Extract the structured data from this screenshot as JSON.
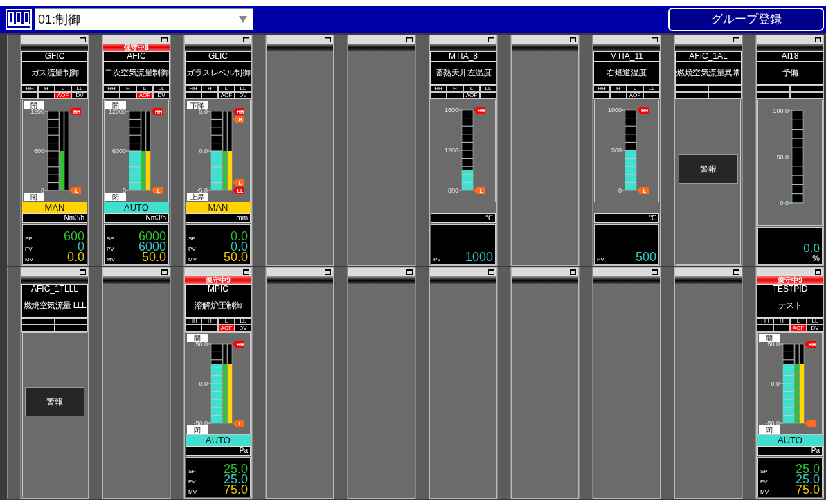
{
  "header": {
    "group_select": {
      "value": "01:制御"
    },
    "register_button": "グループ登録"
  },
  "faceplate_rows": [
    {
      "faceplates": [
        {
          "kind": "controller",
          "tag": "GFIC",
          "description": "ガス流量制御",
          "alarms": [
            {
              "label": "HH"
            },
            {
              "label": "H"
            },
            {
              "label": "L"
            },
            {
              "label": "LL"
            }
          ],
          "flags": [
            {
              "active": false
            },
            {
              "active": false
            },
            {
              "label": "AOF",
              "active": true
            },
            {
              "label": "DV",
              "active": false
            }
          ],
          "top_label": "開",
          "bottom_label": "閉",
          "scale": [
            "1200",
            "600",
            "0"
          ],
          "bars": [
            {
              "kind": "pv",
              "level": 0
            },
            {
              "kind": "sp",
              "level": 0.5
            },
            {
              "kind": "mv",
              "level": 0
            }
          ],
          "markers": [
            {
              "label": "HH",
              "level": 1,
              "color": "#ff0000"
            },
            {
              "label": "L",
              "level": 0,
              "color": "#ff6a1a"
            }
          ],
          "mode": {
            "label": "MAN",
            "kind": "manual"
          },
          "unit": "Nm3/h",
          "values": [
            {
              "label": "SP",
              "value": "600",
              "kind": "sp"
            },
            {
              "label": "PV",
              "value": "0",
              "kind": "pv"
            },
            {
              "label": "MV",
              "value": "0.0",
              "kind": "mv"
            }
          ]
        },
        {
          "kind": "controller",
          "maintenance": "保守中8",
          "tag": "AFIC",
          "description": "二次空気流量制御",
          "alarms": [
            {
              "label": "HH"
            },
            {
              "label": "H"
            },
            {
              "label": "L"
            },
            {
              "label": "LL"
            }
          ],
          "flags": [
            {
              "active": false
            },
            {
              "active": false
            },
            {
              "label": "AOF",
              "active": true
            },
            {
              "label": "DV",
              "active": false
            }
          ],
          "top_label": "開",
          "bottom_label": "閉",
          "scale": [
            "12000",
            "6000",
            "0"
          ],
          "bars": [
            {
              "kind": "pv",
              "level": 0.5
            },
            {
              "kind": "sp",
              "level": 0.5
            },
            {
              "kind": "mv",
              "level": 0.5
            }
          ],
          "markers": [
            {
              "label": "HH",
              "level": 1,
              "color": "#ff0000"
            },
            {
              "label": "L",
              "level": 0,
              "color": "#ff6a1a"
            }
          ],
          "mode": {
            "label": "AUTO",
            "kind": "auto"
          },
          "unit": "Nm3/h",
          "values": [
            {
              "label": "SP",
              "value": "6000",
              "kind": "sp"
            },
            {
              "label": "PV",
              "value": "6000",
              "kind": "pv"
            },
            {
              "label": "MV",
              "value": "50.0",
              "kind": "mv"
            }
          ]
        },
        {
          "kind": "controller",
          "tag": "GLIC",
          "description": "ガラスレベル制御",
          "alarms": [
            {
              "label": "HH"
            },
            {
              "label": "H"
            },
            {
              "label": "L"
            },
            {
              "label": "LL"
            }
          ],
          "flags": [
            {
              "active": false
            },
            {
              "active": false
            },
            {
              "label": "AOF",
              "active": false
            },
            {
              "label": "DV",
              "active": false
            }
          ],
          "top_label": "下降",
          "bottom_label": "上昇",
          "scale": [
            "5.0",
            "0.0",
            "-5.0"
          ],
          "bars": [
            {
              "kind": "pv",
              "level": 0.5
            },
            {
              "kind": "sp",
              "level": 0.5
            },
            {
              "kind": "mv",
              "level": 0.5
            }
          ],
          "markers": [
            {
              "label": "HH",
              "level": 1,
              "color": "#ff0000"
            },
            {
              "label": "H",
              "level": 0.9,
              "color": "#ff6a1a"
            },
            {
              "label": "L",
              "level": 0.1,
              "color": "#ff6a1a"
            },
            {
              "label": "LL",
              "level": 0,
              "color": "#ff0000"
            }
          ],
          "mode": {
            "label": "MAN",
            "kind": "manual"
          },
          "unit": "mm",
          "values": [
            {
              "label": "SP",
              "value": "0.0",
              "kind": "sp"
            },
            {
              "label": "PV",
              "value": "0.0",
              "kind": "pv"
            },
            {
              "label": "MV",
              "value": "50.0",
              "kind": "mv"
            }
          ]
        },
        {
          "kind": "empty"
        },
        {
          "kind": "empty"
        },
        {
          "kind": "indicator",
          "tag": "MTIA_8",
          "description": "蓄熱天井左温度",
          "alarms": [
            {
              "label": "HH"
            },
            {
              "label": "H"
            },
            {
              "label": "L"
            },
            {
              "label": "LL"
            }
          ],
          "flags": [
            {
              "active": false
            },
            {
              "active": false
            },
            {
              "label": "AOF",
              "active": false
            },
            {
              "active": false
            }
          ],
          "scale": [
            "1600",
            "1200",
            "800"
          ],
          "bars": [
            {
              "kind": "pv",
              "level": 0.25
            }
          ],
          "markers": [
            {
              "label": "HH",
              "level": 1,
              "color": "#ff0000"
            },
            {
              "label": "L",
              "level": 0,
              "color": "#ff6a1a"
            }
          ],
          "unit": "℃",
          "values": [
            {
              "label": "PV",
              "value": "1000",
              "kind": "pv"
            }
          ]
        },
        {
          "kind": "empty"
        },
        {
          "kind": "indicator",
          "tag": "MTIA_11",
          "description": "右煙道温度",
          "alarms": [
            {
              "label": "HH"
            },
            {
              "label": "H"
            },
            {
              "label": "L"
            },
            {
              "label": "LL"
            }
          ],
          "flags": [
            {
              "active": false
            },
            {
              "active": false
            },
            {
              "label": "AOF",
              "active": false
            },
            {
              "active": false
            }
          ],
          "scale": [
            "1000",
            "500",
            "0"
          ],
          "bars": [
            {
              "kind": "pv",
              "level": 0.5
            }
          ],
          "markers": [
            {
              "label": "HH",
              "level": 1,
              "color": "#ff0000"
            },
            {
              "label": "L",
              "level": 0,
              "color": "#ff6a1a"
            }
          ],
          "unit": "℃",
          "values": [
            {
              "label": "PV",
              "value": "500",
              "kind": "pv"
            }
          ]
        },
        {
          "kind": "alarm",
          "tag": "AFIC_1AL",
          "description": "燃焼空気流量異常",
          "alarm_button": "警報"
        },
        {
          "kind": "analog",
          "tag": "AI18",
          "description": "予備",
          "scale": [
            "100.0",
            "50.0",
            "0.0"
          ],
          "bars": [
            {
              "kind": "pv",
              "level": 0
            }
          ],
          "value": "0.0",
          "unit": "%"
        }
      ]
    },
    {
      "faceplates": [
        {
          "kind": "alarm",
          "tag": "AFIC_1TLLL",
          "description": "燃焼空気流量 LLL",
          "alarm_button": "警報"
        },
        {
          "kind": "empty"
        },
        {
          "kind": "controller",
          "maintenance": "保守中9",
          "tag": "MPIC",
          "description": "溶解炉圧制御",
          "alarms": [
            {
              "label": "HH"
            },
            {
              "label": "H"
            },
            {
              "label": "L"
            },
            {
              "label": "LL"
            }
          ],
          "flags": [
            {
              "active": false
            },
            {
              "active": false
            },
            {
              "label": "AOF",
              "active": true
            },
            {
              "label": "DV",
              "active": false
            }
          ],
          "top_label": "開",
          "bottom_label": "閉",
          "scale": [
            "50.0",
            "0.0",
            "-50.0"
          ],
          "bars": [
            {
              "kind": "pv",
              "level": 0.75
            },
            {
              "kind": "sp",
              "level": 0.75
            },
            {
              "kind": "mv",
              "level": 0.75
            }
          ],
          "markers": [
            {
              "label": "HH",
              "level": 1,
              "color": "#ff0000"
            },
            {
              "label": "L",
              "level": 0,
              "color": "#ff6a1a"
            }
          ],
          "mode": {
            "label": "AUTO",
            "kind": "auto"
          },
          "unit": "Pa",
          "values": [
            {
              "label": "SP",
              "value": "25.0",
              "kind": "sp"
            },
            {
              "label": "PV",
              "value": "25.0",
              "kind": "pv"
            },
            {
              "label": "MV",
              "value": "75.0",
              "kind": "mv"
            }
          ]
        },
        {
          "kind": "empty"
        },
        {
          "kind": "empty"
        },
        {
          "kind": "empty"
        },
        {
          "kind": "empty"
        },
        {
          "kind": "empty"
        },
        {
          "kind": "empty"
        },
        {
          "kind": "controller",
          "maintenance": "保守中9",
          "tag": "TESTPID",
          "description": "テスト",
          "alarms": [
            {
              "label": "HH"
            },
            {
              "label": "H"
            },
            {
              "label": "L"
            },
            {
              "label": "LL"
            }
          ],
          "flags": [
            {
              "active": false
            },
            {
              "active": false
            },
            {
              "label": "AOF",
              "active": true
            },
            {
              "label": "DV",
              "active": false
            }
          ],
          "top_label": "開",
          "bottom_label": "閉",
          "scale": [
            "50.0",
            "0.0",
            "-50.0"
          ],
          "bars": [
            {
              "kind": "pv",
              "level": 0.75
            },
            {
              "kind": "sp",
              "level": 0.75
            },
            {
              "kind": "mv",
              "level": 0.75
            }
          ],
          "markers": [
            {
              "label": "HH",
              "level": 1,
              "color": "#ff0000"
            },
            {
              "label": "L",
              "level": 0,
              "color": "#ff6a1a"
            }
          ],
          "mode": {
            "label": "AUTO",
            "kind": "auto"
          },
          "unit": "Pa",
          "values": [
            {
              "label": "SP",
              "value": "25.0",
              "kind": "sp"
            },
            {
              "label": "PV",
              "value": "25.0",
              "kind": "pv"
            },
            {
              "label": "MV",
              "value": "75.0",
              "kind": "mv"
            }
          ]
        }
      ]
    }
  ]
}
